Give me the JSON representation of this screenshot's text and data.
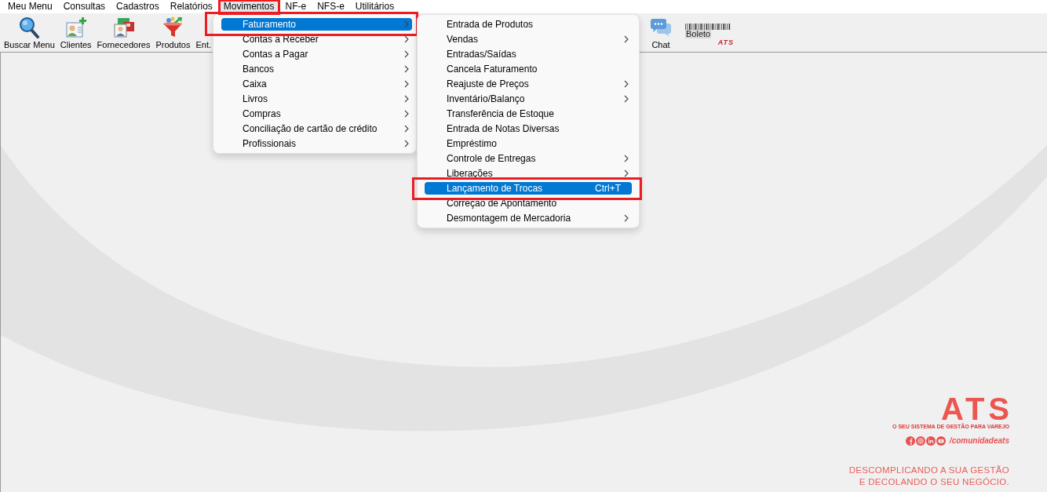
{
  "menu_bar": [
    {
      "label": "Meu Menu",
      "selected": false,
      "highlighted": false
    },
    {
      "label": "Consultas",
      "selected": false,
      "highlighted": false
    },
    {
      "label": "Cadastros",
      "selected": false,
      "highlighted": false
    },
    {
      "label": "Relatórios",
      "selected": false,
      "highlighted": false
    },
    {
      "label": "Movimentos",
      "selected": true,
      "highlighted": true
    },
    {
      "label": "NF-e",
      "selected": false,
      "highlighted": false
    },
    {
      "label": "NFS-e",
      "selected": false,
      "highlighted": false
    },
    {
      "label": "Utilitários",
      "selected": false,
      "highlighted": false
    }
  ],
  "toolbar": {
    "buttons": [
      {
        "label": "Buscar Menu"
      },
      {
        "label": "Clientes"
      },
      {
        "label": "Fornecedores"
      },
      {
        "label": "Produtos"
      },
      {
        "label": "Ent."
      }
    ],
    "right_buttons": [
      {
        "label": "Chat"
      }
    ],
    "boleto_logo": {
      "text": "Boleto",
      "brand": "ATS"
    }
  },
  "movimentos_menu": {
    "items": [
      {
        "label": "Faturamento",
        "submenu": true,
        "selected": true,
        "highlighted": true
      },
      {
        "label": "Contas a Receber",
        "submenu": true,
        "selected": false,
        "highlighted": false
      },
      {
        "label": "Contas a Pagar",
        "submenu": true,
        "selected": false,
        "highlighted": false
      },
      {
        "label": "Bancos",
        "submenu": true,
        "selected": false,
        "highlighted": false
      },
      {
        "label": "Caixa",
        "submenu": true,
        "selected": false,
        "highlighted": false
      },
      {
        "label": "Livros",
        "submenu": true,
        "selected": false,
        "highlighted": false
      },
      {
        "label": "Compras",
        "submenu": true,
        "selected": false,
        "highlighted": false
      },
      {
        "label": "Conciliação de cartão de crédito",
        "submenu": true,
        "selected": false,
        "highlighted": false
      },
      {
        "label": "Profissionais",
        "submenu": true,
        "selected": false,
        "highlighted": false
      }
    ]
  },
  "faturamento_menu": {
    "items": [
      {
        "label": "Entrada de Produtos",
        "submenu": false,
        "selected": false,
        "highlighted": false
      },
      {
        "label": "Vendas",
        "submenu": true,
        "selected": false,
        "highlighted": false
      },
      {
        "label": "Entradas/Saídas",
        "submenu": false,
        "selected": false,
        "highlighted": false
      },
      {
        "label": "Cancela Faturamento",
        "submenu": false,
        "selected": false,
        "highlighted": false
      },
      {
        "label": "Reajuste de Preços",
        "submenu": true,
        "selected": false,
        "highlighted": false
      },
      {
        "label": "Inventário/Balanço",
        "submenu": true,
        "selected": false,
        "highlighted": false
      },
      {
        "label": "Transferência de Estoque",
        "submenu": false,
        "selected": false,
        "highlighted": false
      },
      {
        "label": "Entrada de Notas Diversas",
        "submenu": false,
        "selected": false,
        "highlighted": false
      },
      {
        "label": "Empréstimo",
        "submenu": false,
        "selected": false,
        "highlighted": false
      },
      {
        "label": "Controle de Entregas",
        "submenu": true,
        "selected": false,
        "highlighted": false
      },
      {
        "label": "Liberações",
        "submenu": true,
        "selected": false,
        "highlighted": false
      },
      {
        "label": "Lançamento de Trocas",
        "shortcut": "Ctrl+T",
        "submenu": false,
        "selected": true,
        "highlighted": true
      },
      {
        "label": "Correção de Apontamento",
        "submenu": false,
        "selected": false,
        "highlighted": false
      },
      {
        "label": "Desmontagem de Mercadoria",
        "submenu": true,
        "selected": false,
        "highlighted": false
      }
    ]
  },
  "brand_panel": {
    "logo": "ATS",
    "slogan": "O SEU SISTEMA DE GESTÃO PARA VAREJO",
    "social_handle": "/comunidadeats",
    "tagline": [
      "DESCOMPLICANDO A SUA GESTÃO",
      "E DECOLANDO O SEU NEGÓCIO."
    ]
  }
}
